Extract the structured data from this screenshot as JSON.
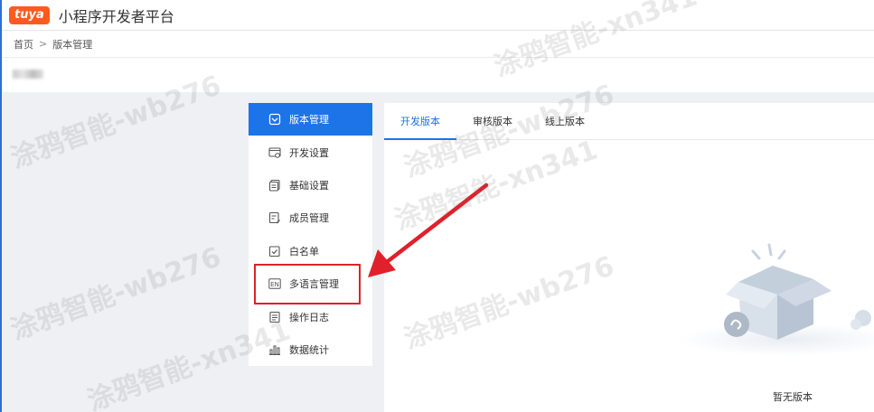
{
  "header": {
    "logo_text": "tuya",
    "app_title": "小程序开发者平台",
    "accent_color": "#ff5a1f"
  },
  "breadcrumb": {
    "home": "首页",
    "separator": ">",
    "current": "版本管理"
  },
  "sidebar": {
    "active_color": "#1d73e8",
    "items": [
      {
        "label": "版本管理",
        "icon": "version-icon",
        "active": true
      },
      {
        "label": "开发设置",
        "icon": "dev-settings-icon",
        "active": false
      },
      {
        "label": "基础设置",
        "icon": "basic-settings-icon",
        "active": false
      },
      {
        "label": "成员管理",
        "icon": "members-icon",
        "active": false
      },
      {
        "label": "白名单",
        "icon": "whitelist-icon",
        "active": false
      },
      {
        "label": "多语言管理",
        "icon": "language-en-icon",
        "active": false
      },
      {
        "label": "操作日志",
        "icon": "log-icon",
        "active": false
      },
      {
        "label": "数据统计",
        "icon": "stats-icon",
        "active": false
      }
    ]
  },
  "tabs": [
    {
      "label": "开发版本",
      "active": true
    },
    {
      "label": "审核版本",
      "active": false
    },
    {
      "label": "线上版本",
      "active": false
    }
  ],
  "empty_state": {
    "text": "暂无版本",
    "icon": "empty-box-icon"
  },
  "annotation": {
    "color": "#e0202a",
    "arrow_icon": "red-arrow-icon"
  },
  "watermark": {
    "lines": [
      "涂鸦智能-wb276",
      "涂鸦智能-xn341"
    ]
  }
}
